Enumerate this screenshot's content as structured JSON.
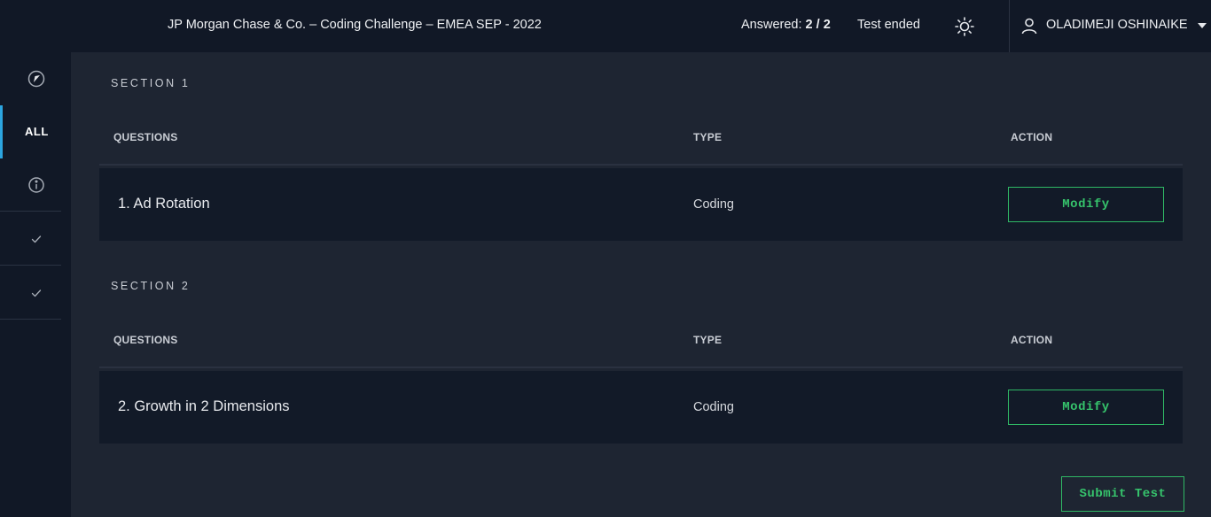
{
  "header": {
    "title": "JP Morgan Chase & Co. – Coding Challenge – EMEA SEP - 2022",
    "answered_label": "Answered:",
    "answered_value": "2 / 2",
    "status": "Test ended",
    "theme_icon": "sun-icon",
    "user_icon": "user-icon",
    "user_name": "OLADIMEJI OSHINAIKE"
  },
  "sidebar": {
    "logo_icon": "compass-icon",
    "all_label": "ALL",
    "info_icon": "info-icon",
    "items": [
      {
        "icon": "checkmark-icon"
      },
      {
        "icon": "checkmark-icon"
      }
    ]
  },
  "columns": {
    "questions": "QUESTIONS",
    "type": "TYPE",
    "action": "ACTION"
  },
  "sections": [
    {
      "label": "SECTION 1",
      "question": {
        "title": "1. Ad Rotation",
        "type": "Coding",
        "action": "Modify"
      }
    },
    {
      "label": "SECTION 2",
      "question": {
        "title": "2. Growth in 2 Dimensions",
        "type": "Coding",
        "action": "Modify"
      }
    }
  ],
  "footer": {
    "submit_label": "Submit Test"
  },
  "colors": {
    "background": "#1e2532",
    "panel": "#111826",
    "accent_blue": "#2ca5e0",
    "accent_green": "#36c46c"
  }
}
